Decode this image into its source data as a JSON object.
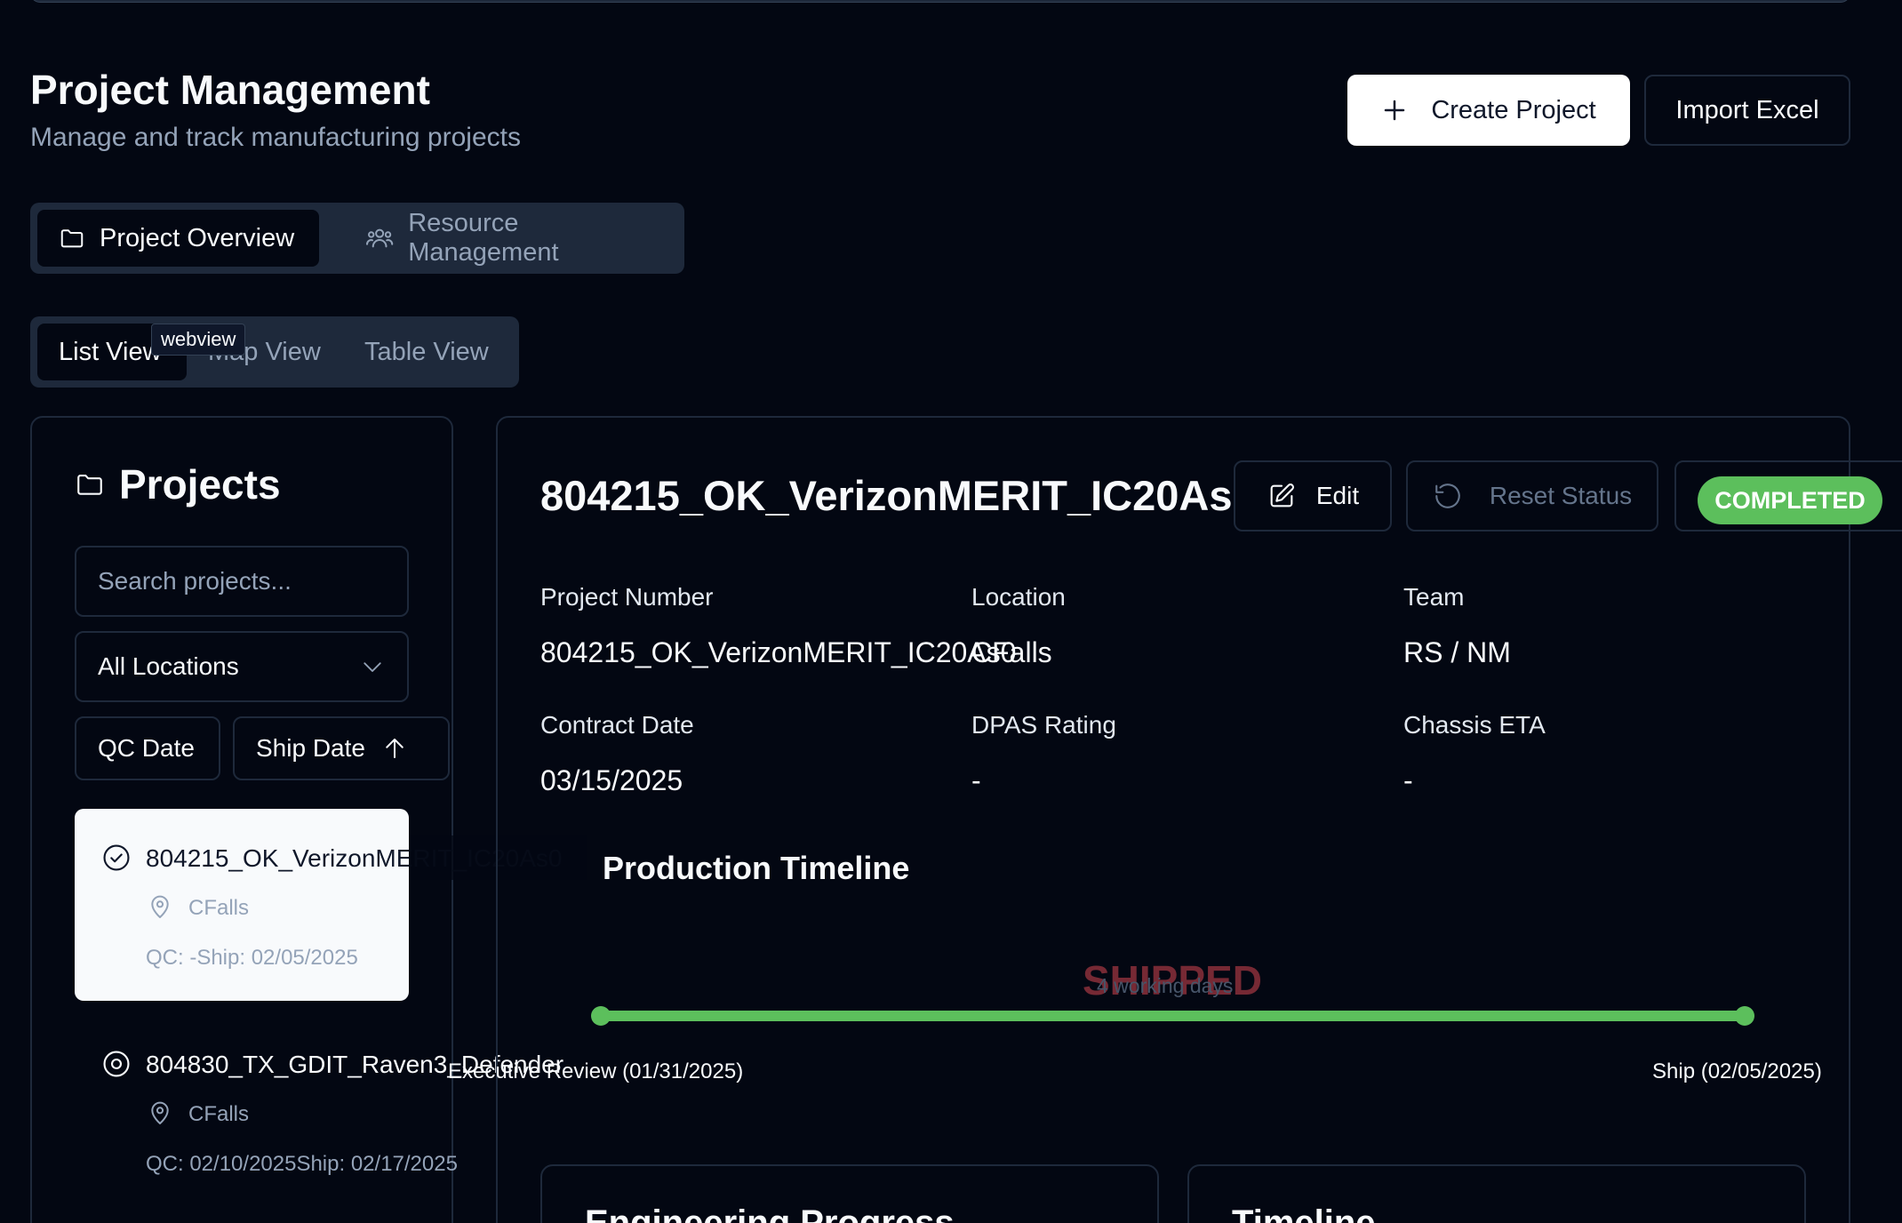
{
  "header": {
    "title": "Project Management",
    "subtitle": "Manage and track manufacturing projects",
    "create_label": "Create Project",
    "import_label": "Import Excel"
  },
  "main_tabs": [
    {
      "label": "Project Overview",
      "icon": "folder-icon",
      "active": true
    },
    {
      "label": "Resource Management",
      "icon": "users-icon",
      "active": false
    }
  ],
  "view_tabs": [
    {
      "label": "List View",
      "active": true
    },
    {
      "label": "Map View",
      "active": false
    },
    {
      "label": "Table View",
      "active": false
    }
  ],
  "tooltip": "webview",
  "projects_panel": {
    "title": "Projects",
    "search_placeholder": "Search projects...",
    "location_filter": "All Locations",
    "sort_qc": "QC Date",
    "sort_ship": "Ship Date",
    "items": [
      {
        "name": "804215_OK_VerizonMERIT_IC20As0",
        "location": "CFalls",
        "dates": "QC: -Ship: 02/05/2025",
        "status_icon": "check-circle-icon",
        "selected": true
      },
      {
        "name": "804830_TX_GDIT_Raven3_Defender",
        "location": "CFalls",
        "dates": "QC: 02/10/2025Ship: 02/17/2025",
        "status_icon": "target-circle-icon",
        "selected": false
      }
    ]
  },
  "detail": {
    "title": "804215_OK_VerizonMERIT_IC20As0",
    "edit_label": "Edit",
    "reset_label": "Reset Status",
    "status": "COMPLETED",
    "fields": {
      "project_number_label": "Project Number",
      "project_number": "804215_OK_VerizonMERIT_IC20As0",
      "location_label": "Location",
      "location": "CFalls",
      "team_label": "Team",
      "team": "RS / NM",
      "contract_date_label": "Contract Date",
      "contract_date": "03/15/2025",
      "dpas_label": "DPAS Rating",
      "dpas": "-",
      "chassis_label": "Chassis ETA",
      "chassis": "-"
    },
    "timeline": {
      "title": "Production Timeline",
      "phase": "SHIPPED",
      "duration": "4 working days",
      "start_label": "Executive Review (01/31/2025)",
      "end_label": "Ship (02/05/2025)"
    },
    "cards": {
      "left_title": "Engineering Progress",
      "right_title": "Timeline"
    }
  },
  "colors": {
    "background": "#030712",
    "accent_green": "#5cbf5c",
    "border": "#1e293b",
    "muted_text": "#94a3b8",
    "shipped_red": "#8b2f3a"
  }
}
